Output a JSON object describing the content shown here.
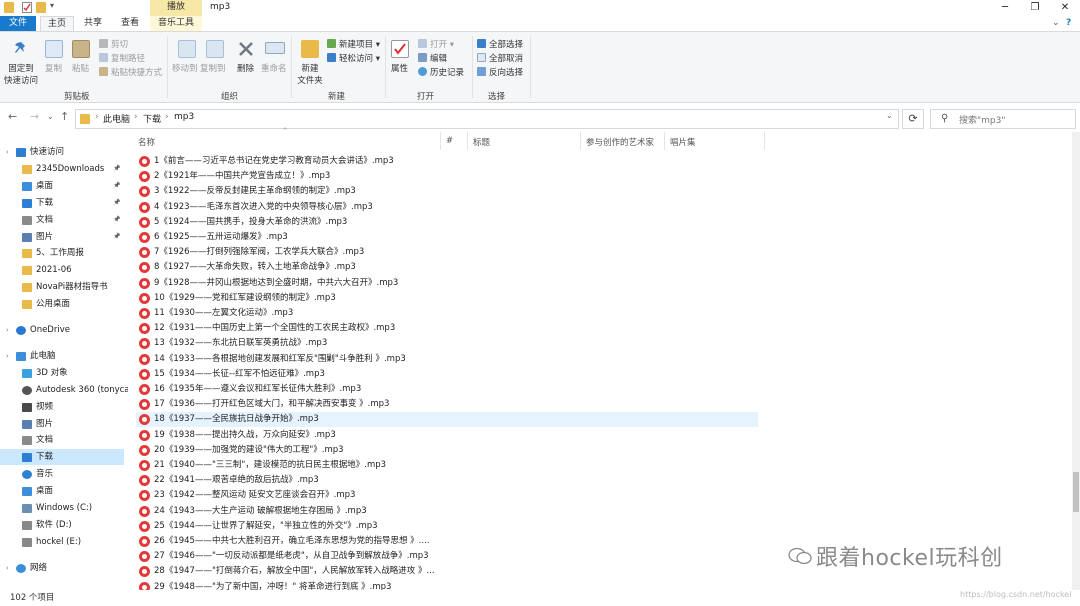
{
  "window": {
    "context_header": "播放",
    "title": "mp3",
    "quick_access_dropdown": "▾"
  },
  "tabs": {
    "file": "文件",
    "home": "主页",
    "share": "共享",
    "view": "查看",
    "music_tools": "音乐工具",
    "collapse": "⌄",
    "help": "?"
  },
  "ribbon": {
    "clipboard": {
      "pin_line1": "固定到",
      "pin_line2": "快速访问",
      "copy": "复制",
      "paste": "粘贴",
      "cut": "剪切",
      "copy_path": "复制路径",
      "paste_shortcut": "粘贴快捷方式",
      "group": "剪贴板"
    },
    "organize": {
      "move_to": "移动到",
      "copy_to": "复制到",
      "delete": "删除",
      "rename": "重命名",
      "group": "组织"
    },
    "new": {
      "new_folder_line1": "新建",
      "new_folder_line2": "文件夹",
      "new_item": "新建项目 ▾",
      "easy_access": "轻松访问 ▾",
      "group": "新建"
    },
    "open": {
      "properties": "属性",
      "open": "打开 ▾",
      "edit": "编辑",
      "history": "历史记录",
      "group": "打开"
    },
    "select": {
      "select_all": "全部选择",
      "select_none": "全部取消",
      "invert": "反向选择",
      "group": "选择"
    }
  },
  "address": {
    "crumb1": "此电脑",
    "crumb2": "下载",
    "crumb3": "mp3",
    "search_placeholder": "搜索\"mp3\""
  },
  "columns": {
    "name": "名称",
    "number": "#",
    "title": "标题",
    "artist": "参与创作的艺术家",
    "album": "唱片集"
  },
  "sidebar": [
    {
      "label": "快速访问",
      "icon": "star-icon",
      "color": "#2d7fd3",
      "indent": 0
    },
    {
      "label": "2345Downloads",
      "icon": "folder-icon",
      "color": "#e9b949",
      "indent": 1,
      "pin": true
    },
    {
      "label": "桌面",
      "icon": "desktop-icon",
      "color": "#3a8fd8",
      "indent": 1,
      "pin": true
    },
    {
      "label": "下载",
      "icon": "download-icon",
      "color": "#2d7fd3",
      "indent": 1,
      "pin": true
    },
    {
      "label": "文档",
      "icon": "document-icon",
      "color": "#8a8a8a",
      "indent": 1,
      "pin": true
    },
    {
      "label": "图片",
      "icon": "picture-icon",
      "color": "#5b7fb0",
      "indent": 1,
      "pin": true
    },
    {
      "label": "5、工作周报",
      "icon": "folder-icon",
      "color": "#e9b949",
      "indent": 1
    },
    {
      "label": "2021-06",
      "icon": "folder-icon",
      "color": "#e9b949",
      "indent": 1
    },
    {
      "label": "NovaPi器材指导书",
      "icon": "folder-icon",
      "color": "#e9b949",
      "indent": 1
    },
    {
      "label": "公用桌面",
      "icon": "folder-icon",
      "color": "#e9b949",
      "indent": 1
    },
    {
      "label": "",
      "spacer": true
    },
    {
      "label": "OneDrive",
      "icon": "cloud-icon",
      "color": "#2b78d0",
      "indent": 0
    },
    {
      "label": "",
      "spacer": true
    },
    {
      "label": "此电脑",
      "icon": "computer-icon",
      "color": "#3a8fd8",
      "indent": 0
    },
    {
      "label": "3D 对象",
      "icon": "cube-icon",
      "color": "#3aa0e0",
      "indent": 1
    },
    {
      "label": "Autodesk 360 (tonyca",
      "icon": "cloud-icon",
      "color": "#555555",
      "indent": 1
    },
    {
      "label": "视频",
      "icon": "video-icon",
      "color": "#4a4a4a",
      "indent": 1
    },
    {
      "label": "图片",
      "icon": "picture-icon",
      "color": "#5b7fb0",
      "indent": 1
    },
    {
      "label": "文档",
      "icon": "document-icon",
      "color": "#8a8a8a",
      "indent": 1
    },
    {
      "label": "下载",
      "icon": "download-icon",
      "color": "#2d7fd3",
      "indent": 1,
      "selected": true
    },
    {
      "label": "音乐",
      "icon": "music-icon",
      "color": "#2d7fd3",
      "indent": 1
    },
    {
      "label": "桌面",
      "icon": "desktop-icon",
      "color": "#3a8fd8",
      "indent": 1
    },
    {
      "label": "Windows (C:)",
      "icon": "drive-icon",
      "color": "#6a8fb3",
      "indent": 1
    },
    {
      "label": "软件 (D:)",
      "icon": "drive-icon",
      "color": "#888888",
      "indent": 1
    },
    {
      "label": "hockel (E:)",
      "icon": "drive-icon",
      "color": "#888888",
      "indent": 1
    },
    {
      "label": "",
      "spacer": true
    },
    {
      "label": "网络",
      "icon": "network-icon",
      "color": "#3a8fd8",
      "indent": 0
    }
  ],
  "files": [
    "1《前言——习近平总书记在党史学习教育动员大会讲话》.mp3",
    "2《1921年——中国共产党宣告成立！》.mp3",
    "3《1922——反帝反封建民主革命纲领的制定》.mp3",
    "4《1923——毛泽东首次进入党的中央领导核心层》.mp3",
    "5《1924——国共携手，投身大革命的洪流》.mp3",
    "6《1925——五卅运动爆发》.mp3",
    "7《1926——打倒列强除军阀，工农学兵大联合》.mp3",
    "8《1927——大革命失败，转入土地革命战争》.mp3",
    "9《1928——井冈山根据地达到全盛时期，中共六大召开》.mp3",
    "10《1929——党和红军建设纲领的制定》.mp3",
    "11《1930——左翼文化运动》.mp3",
    "12《1931——中国历史上第一个全国性的工农民主政权》.mp3",
    "13《1932——东北抗日联军英勇抗战》.mp3",
    "14《1933——各根据地创建发展和红军反\"围剿\"斗争胜利 》.mp3",
    "15《1934——长征--红军不怕远征难》.mp3",
    "16《1935年——遵义会议和红军长征伟大胜利》.mp3",
    "17《1936——打开红色区域大门，和平解决西安事变 》.mp3",
    "18《1937——全民族抗日战争开始》.mp3",
    "19《1938——提出持久战，万众向延安》.mp3",
    "20《1939——加强党的建设\"伟大的工程\"》.mp3",
    "21《1940——\"三三制\"，建设模范的抗日民主根据地》.mp3",
    "22《1941——艰苦卓绝的敌后抗战》.mp3",
    "23《1942——整风运动 延安文艺座谈会召开》.mp3",
    "24《1943——大生产运动 破解根据地生存困局 》.mp3",
    "25《1944——让世界了解延安，\"半独立性的外交\"》.mp3",
    "26《1945——中共七大胜利召开，确立毛泽东思想为党的指导思想 》....",
    "27《1946——\"一切反动派都是纸老虎\"，从自卫战争到解放战争》.mp3",
    "28《1947——\"打倒蒋介石，解放全中国\"，人民解放军转入战略进攻 》...",
    "29《1948——\"为了新中国，冲呀！\" 将革命进行到底 》.mp3"
  ],
  "selected_index": 17,
  "status": {
    "count": "102 个项目"
  },
  "watermark": {
    "text": "跟着hockel玩科创",
    "url": "https://blog.csdn.net/hockel"
  }
}
